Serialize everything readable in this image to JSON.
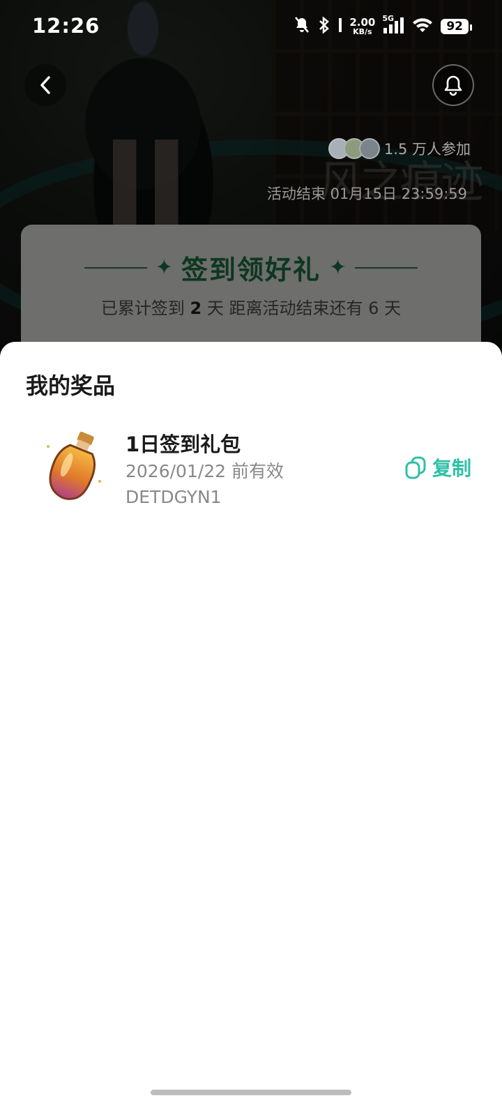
{
  "status_bar": {
    "time": "12:26",
    "net_speed_value": "2.00",
    "net_speed_unit": "KB/s",
    "network_type": "5G",
    "battery": "92",
    "icons": [
      "bell-off-icon",
      "bluetooth-icon",
      "signal-icon",
      "wifi-icon",
      "battery-icon"
    ]
  },
  "hero": {
    "participants": "1.5 万人参加",
    "end_time": "活动结束 01月15日 23:59:59",
    "logo_text": "风之痕迹"
  },
  "checkin": {
    "title": "签到领好礼",
    "sub_prefix": "已累计签到",
    "days": "2",
    "sub_mid": "天  距离活动结束还有",
    "remaining": "6",
    "sub_suffix": "天",
    "accent_color": "#1e7a4b"
  },
  "sheet": {
    "title": "我的奖品",
    "prizes": [
      {
        "name": "1日签到礼包",
        "expire": "2026/01/22 前有效",
        "code": "DETDGYN1",
        "copy_label": "复制"
      }
    ],
    "copy_color": "#2fbfa7"
  }
}
